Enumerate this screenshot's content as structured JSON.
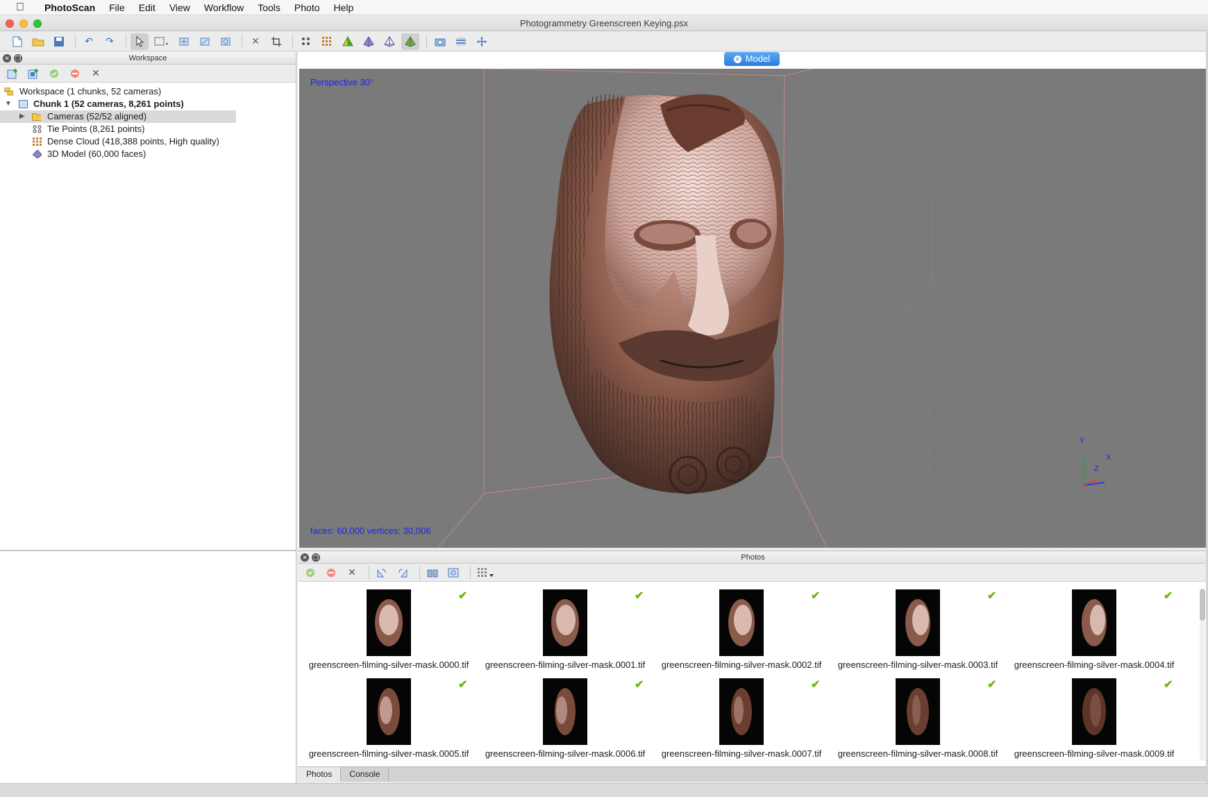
{
  "menubar": {
    "app": "PhotoScan",
    "items": [
      "File",
      "Edit",
      "View",
      "Workflow",
      "Tools",
      "Photo",
      "Help"
    ]
  },
  "window": {
    "title": "Photogrammetry Greenscreen Keying.psx"
  },
  "toolbar": {
    "icons": [
      "new-icon",
      "open-icon",
      "save-icon",
      "undo-icon",
      "redo-icon",
      "select-icon",
      "rect-select-icon",
      "move-region-icon",
      "rotate-region-icon",
      "resize-region-icon",
      "delete-icon",
      "crop-icon",
      "point-cloud-icon",
      "dense-cloud-icon",
      "shaded-model-icon",
      "solid-model-icon",
      "wireframe-model-icon",
      "textured-model-icon",
      "show-cameras-icon",
      "show-region-icon",
      "reset-view-icon"
    ]
  },
  "workspace": {
    "title": "Workspace",
    "tree": {
      "root": "Workspace (1 chunks, 52 cameras)",
      "chunk": "Chunk 1 (52 cameras, 8,261 points)",
      "cameras": "Cameras (52/52 aligned)",
      "tie_points": "Tie Points (8,261 points)",
      "dense_cloud": "Dense Cloud (418,388 points, High quality)",
      "model": "3D Model (60,000 faces)"
    }
  },
  "model_view": {
    "tab_label": "Model",
    "projection": "Perspective 30°",
    "stats": "faces: 60,000 vertices: 30,006",
    "axes": {
      "y": "Y",
      "x": "X",
      "z": "Z"
    }
  },
  "photos": {
    "title": "Photos",
    "items": [
      {
        "name": "greenscreen-filming-silver-mask.0000.tif",
        "enabled": true
      },
      {
        "name": "greenscreen-filming-silver-mask.0001.tif",
        "enabled": true
      },
      {
        "name": "greenscreen-filming-silver-mask.0002.tif",
        "enabled": true
      },
      {
        "name": "greenscreen-filming-silver-mask.0003.tif",
        "enabled": true
      },
      {
        "name": "greenscreen-filming-silver-mask.0004.tif",
        "enabled": true
      },
      {
        "name": "greenscreen-filming-silver-mask.0005.tif",
        "enabled": true
      },
      {
        "name": "greenscreen-filming-silver-mask.0006.tif",
        "enabled": true
      },
      {
        "name": "greenscreen-filming-silver-mask.0007.tif",
        "enabled": true
      },
      {
        "name": "greenscreen-filming-silver-mask.0008.tif",
        "enabled": true
      },
      {
        "name": "greenscreen-filming-silver-mask.0009.tif",
        "enabled": true
      }
    ]
  },
  "bottom_tabs": [
    {
      "label": "Photos",
      "active": true
    },
    {
      "label": "Console",
      "active": false
    }
  ],
  "colors": {
    "viewport_bg": "#7a7a7a",
    "overlay_text": "#1a24e6",
    "check": "#6cb80e",
    "tab_accent": "#2b7de0"
  }
}
